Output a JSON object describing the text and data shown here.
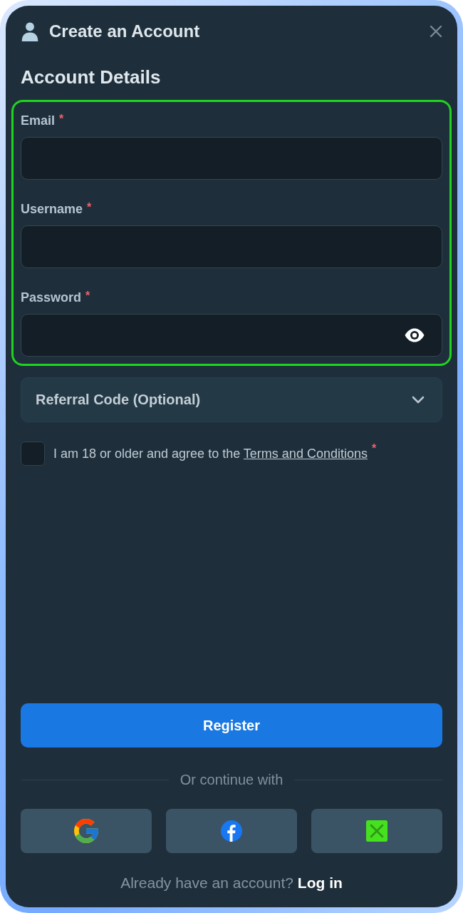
{
  "header": {
    "title": "Create an Account"
  },
  "section": {
    "title": "Account Details"
  },
  "credentials": {
    "highlighted": true,
    "fields": [
      {
        "kind": "text",
        "label": "Email",
        "required_mark": "*"
      },
      {
        "kind": "text",
        "label": "Username",
        "required_mark": "*"
      },
      {
        "kind": "password",
        "label": "Password",
        "required_mark": "*"
      }
    ]
  },
  "referral": {
    "label": "Referral Code (Optional)",
    "expanded": false
  },
  "agreement": {
    "text": "I am 18 or older and agree to the",
    "link": "Terms and Conditions",
    "required_mark": "*",
    "checked": false
  },
  "register": {
    "label": "Register"
  },
  "alternatives": {
    "text": "Or continue with",
    "providers": [
      {
        "kind": "google"
      },
      {
        "kind": "facebook"
      },
      {
        "kind": "cross"
      }
    ]
  },
  "login": {
    "text": "Already have an account?",
    "link": "Log in"
  }
}
